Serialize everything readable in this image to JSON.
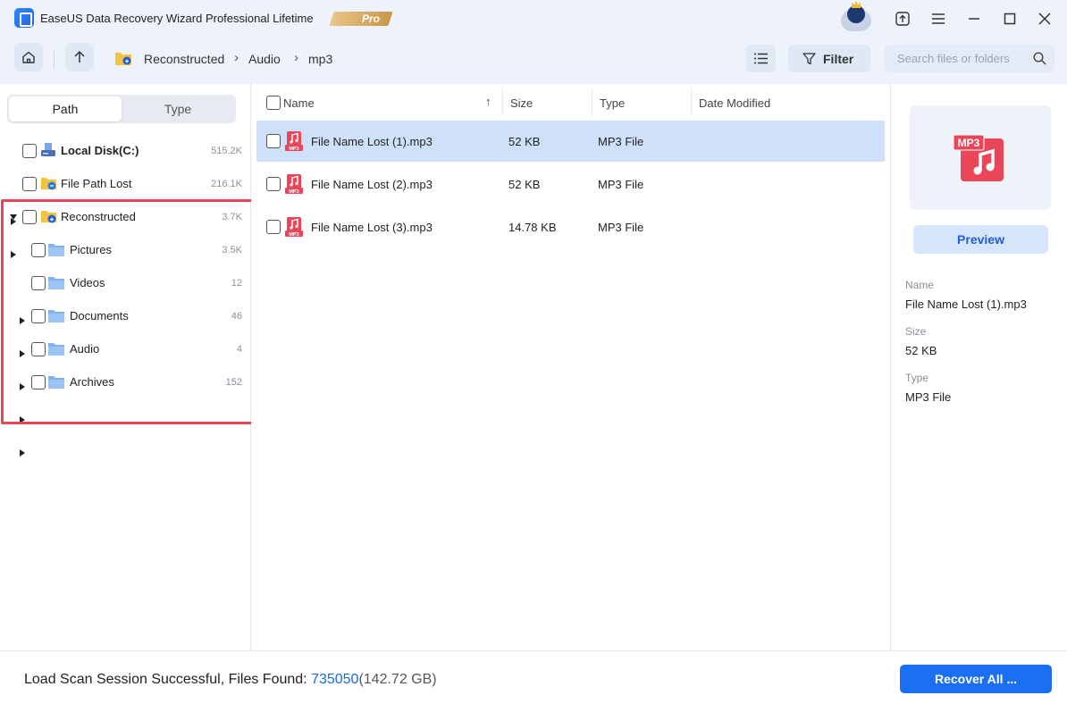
{
  "titlebar": {
    "title": "EaseUS Data Recovery Wizard Professional Lifetime",
    "badge": "Pro"
  },
  "toolbar": {
    "breadcrumb": [
      "Reconstructed",
      "Audio",
      "mp3"
    ],
    "filter_label": "Filter",
    "search_placeholder": "Search files or folders"
  },
  "left_panel": {
    "tabs": [
      "Path",
      "Type"
    ],
    "active_tab": "Path",
    "tree": [
      {
        "label": "Local Disk(C:)",
        "count": "515.2K",
        "level": 0,
        "expanded": false,
        "icon": "disk-icon"
      },
      {
        "label": "File Path Lost",
        "count": "216.1K",
        "level": 0,
        "expanded": false,
        "icon": "folder-lost-icon"
      },
      {
        "label": "Reconstructed",
        "count": "3.7K",
        "level": 0,
        "expanded": true,
        "icon": "folder-reconstructed-icon"
      },
      {
        "label": "Pictures",
        "count": "3.5K",
        "level": 1,
        "expanded": false,
        "icon": "folder-icon"
      },
      {
        "label": "Videos",
        "count": "12",
        "level": 1,
        "expanded": false,
        "icon": "folder-icon"
      },
      {
        "label": "Documents",
        "count": "46",
        "level": 1,
        "expanded": false,
        "icon": "folder-icon"
      },
      {
        "label": "Audio",
        "count": "4",
        "level": 1,
        "expanded": false,
        "icon": "folder-icon"
      },
      {
        "label": "Archives",
        "count": "152",
        "level": 1,
        "expanded": false,
        "icon": "folder-icon"
      }
    ]
  },
  "file_list": {
    "columns": [
      "Name",
      "Size",
      "Type",
      "Date Modified"
    ],
    "rows": [
      {
        "name": "File Name Lost (1).mp3",
        "size": "52 KB",
        "type": "MP3 File",
        "selected": true
      },
      {
        "name": "File Name Lost (2).mp3",
        "size": "52 KB",
        "type": "MP3 File",
        "selected": false
      },
      {
        "name": "File Name Lost (3).mp3",
        "size": "14.78 KB",
        "type": "MP3 File",
        "selected": false
      }
    ]
  },
  "details": {
    "icon_label": "MP3",
    "preview_label": "Preview",
    "name_label": "Name",
    "name_value": "File Name Lost (1).mp3",
    "size_label": "Size",
    "size_value": "52 KB",
    "type_label": "Type",
    "type_value": "MP3 File"
  },
  "status": {
    "message": "Load Scan Session Successful, Files Found: ",
    "count": "735050",
    "size": "(142.72 GB)",
    "recover_label": "Recover All ..."
  },
  "colors": {
    "accent": "#1a6ff2",
    "highlight_border": "#e9465a",
    "selected_row": "#cfe0fb",
    "mp3_icon": "#e9465a"
  }
}
